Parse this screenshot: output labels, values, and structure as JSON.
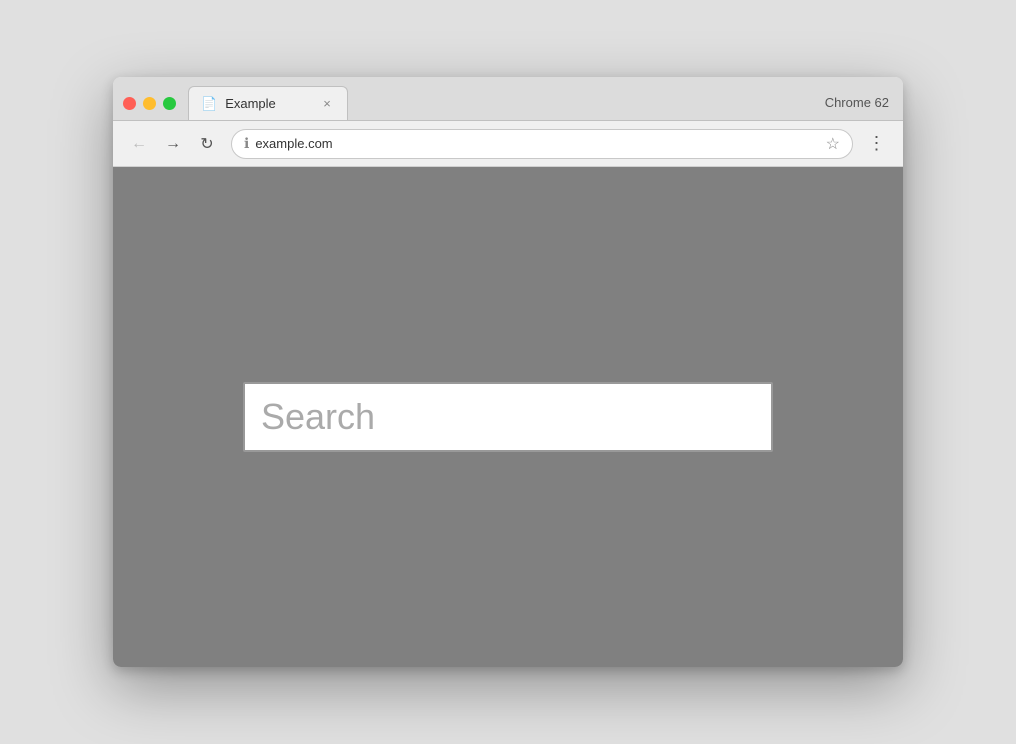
{
  "browser": {
    "chrome_label": "Chrome 62",
    "tab": {
      "title": "Example",
      "icon": "📄"
    },
    "close_symbol": "×",
    "toolbar": {
      "back_label": "←",
      "forward_label": "→",
      "reload_label": "↻",
      "address": "example.com",
      "info_icon": "ℹ",
      "star_icon": "☆",
      "menu_icon": "⋮"
    }
  },
  "page": {
    "search_placeholder": "Search"
  }
}
